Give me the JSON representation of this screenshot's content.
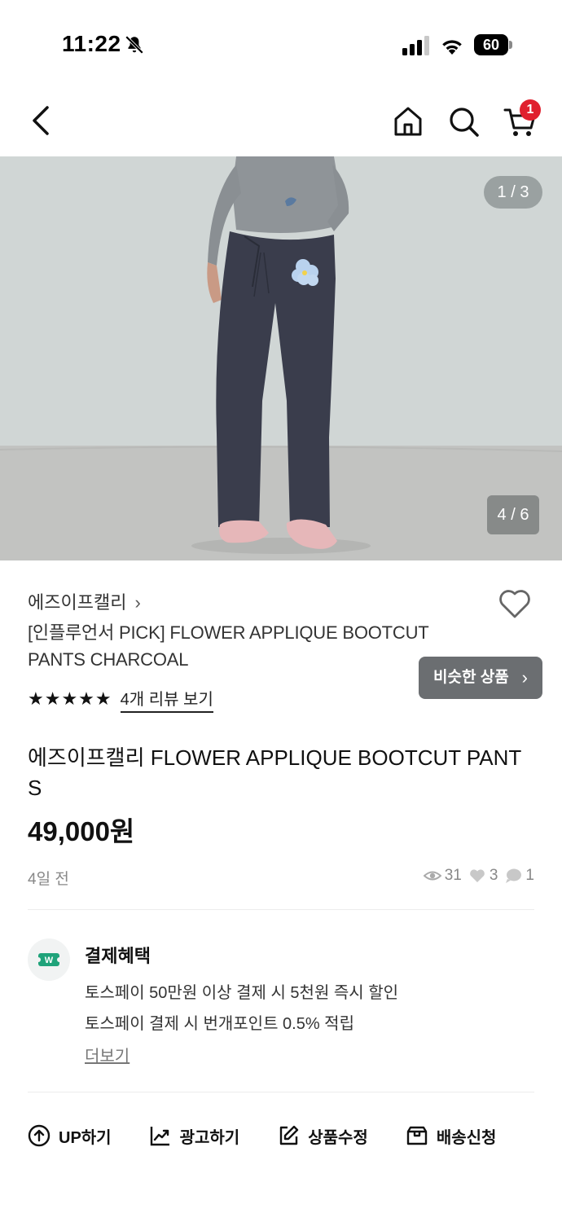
{
  "status_bar": {
    "time": "11:22",
    "battery": "60"
  },
  "nav": {
    "cart_count": "1"
  },
  "product_image": {
    "counter_top": "1 / 3",
    "counter_inner": "4 / 6"
  },
  "product": {
    "brand": "에즈이프캘리",
    "brand_chevron": "›",
    "title": "[인플루언서 PICK] FLOWER APPLIQUE BOOTCUT PANTS CHARCOAL",
    "similar_button": "비슷한 상품",
    "similar_chevron": "›",
    "stars": "★★★★★",
    "rating": 5,
    "review_link": "4개 리뷰 보기",
    "full_title": "에즈이프캘리 FLOWER APPLIQUE BOOTCUT PANTS",
    "price": "49,000원",
    "posted": "4일 전",
    "views": "31",
    "likes": "3",
    "chats": "1"
  },
  "benefits": {
    "title": "결제혜택",
    "line1": "토스페이 50만원 이상 결제 시 5천원 즉시 할인",
    "line2": "토스페이 결제 시 번개포인트 0.5% 적립",
    "more": "더보기"
  },
  "actions": [
    {
      "label": "UP하기",
      "icon": "arrow-up-circle-icon"
    },
    {
      "label": "광고하기",
      "icon": "trend-chart-icon"
    },
    {
      "label": "상품수정",
      "icon": "edit-icon"
    },
    {
      "label": "배송신청",
      "icon": "box-icon"
    }
  ],
  "colors": {
    "badge": "#e0202e",
    "similar_bg": "#6b6e71",
    "pay_icon": "#1fa37a"
  }
}
